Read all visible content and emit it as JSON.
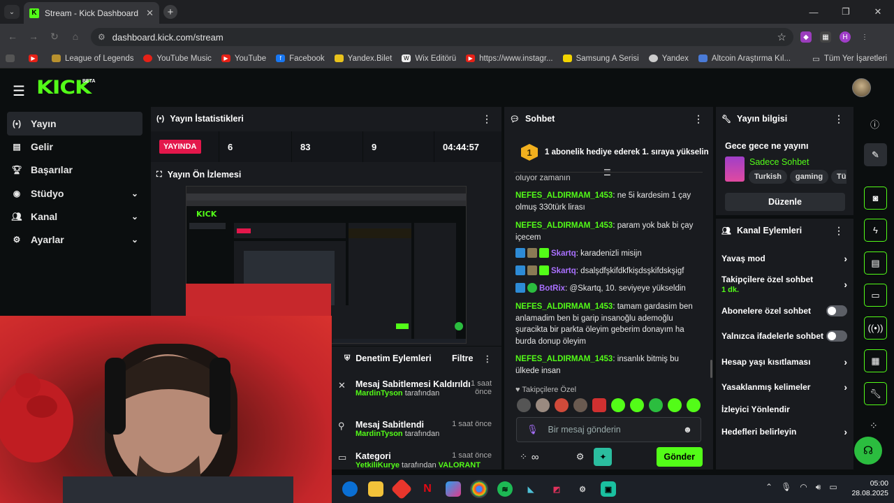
{
  "browser": {
    "tab_title": "Stream - Kick Dashboard",
    "url": "dashboard.kick.com/stream",
    "bookmarks": [
      "League of Legends",
      "YouTube Music",
      "YouTube",
      "Facebook",
      "Yandex.Bilet",
      "Wix Editörü",
      "https://www.instagr...",
      "Samsung A Serisi",
      "Yandex",
      "Altcoin Araştırma Kıl..."
    ],
    "all_bookmarks": "Tüm Yer İşaretleri",
    "ext_profile": "H"
  },
  "header": {
    "logo": "KICK",
    "beta": "BETA"
  },
  "sidebar": {
    "items": [
      {
        "label": "Yayın"
      },
      {
        "label": "Gelir"
      },
      {
        "label": "Başarılar"
      },
      {
        "label": "Stüdyo"
      },
      {
        "label": "Kanal"
      },
      {
        "label": "Ayarlar"
      }
    ]
  },
  "stats": {
    "title": "Yayın İstatistikleri",
    "live_label": "YAYINDA",
    "values": [
      "6",
      "83",
      "9",
      "04:44:57"
    ]
  },
  "preview": {
    "title": "Yayın Ön İzlemesi"
  },
  "moderation": {
    "title": "Denetim Eylemleri",
    "filter": "Filtre",
    "items": [
      {
        "title": "Mesaj Sabitlemesi Kaldırıldı",
        "user": "MardinTyson",
        "by": "tarafından",
        "time": "1 saat önce"
      },
      {
        "title": "Mesaj Sabitlendi",
        "user": "MardinTyson",
        "by": "tarafından",
        "time": "1 saat önce"
      },
      {
        "title": "Kategori",
        "user": "YetkiliKurye",
        "by": "tarafından",
        "extra": "VALORANT",
        "time": "1 saat önce"
      }
    ]
  },
  "chat": {
    "title": "Sohbet",
    "gift_number": "1",
    "gift_text": "1 abonelik hediye ederek 1. sıraya yükselin",
    "partial_top": "oluyor zamanın",
    "messages": [
      {
        "user": "NEFES_ALDIRMAM_1453",
        "text": ": ne 5i kardesim 1 çay olmuş 330türk lirası"
      },
      {
        "user": "NEFES_ALDIRMAM_1453",
        "text": ": param yok bak bi çay içecem"
      },
      {
        "user": "Skartq",
        "text": ": karadenizli misijn"
      },
      {
        "user": "Skartq",
        "text": ": dsalşdfşkifdkfkişdsşkifdskşigf"
      },
      {
        "user": "BotRix",
        "text": ": @Skartq, 10. seviyeye yükseldin"
      },
      {
        "user": "NEFES_ALDIRMAM_1453",
        "text": ": tamam gardasim ben anlamadim ben bi garip insanoğlu ademoğlu şuracikta bir parkta öleyim geberim donayım ha burda donup öleyim"
      },
      {
        "user": "NEFES_ALDIRMAM_1453",
        "text": ": insanlık bitmiş bu ülkede insan"
      }
    ],
    "followers_only": "Takipçilere Özel",
    "input_placeholder": "Bir mesaj gönderin",
    "send": "Gönder"
  },
  "info": {
    "title": "Yayın bilgisi",
    "stream_title": "Gece gece ne yayını",
    "category": "Sadece Sohbet",
    "tags": [
      "Turkish",
      "gaming",
      "Türk"
    ],
    "edit": "Düzenle"
  },
  "channel_actions": {
    "title": "Kanal Eylemleri",
    "items": [
      {
        "label": "Yavaş mod",
        "type": "arrow"
      },
      {
        "label": "Takipçilere özel sohbet",
        "sub": "1 dk.",
        "type": "arrow"
      },
      {
        "label": "Abonelere özel sohbet",
        "type": "toggle"
      },
      {
        "label": "Yalnızca ifadelerle sohbet",
        "type": "toggle"
      },
      {
        "label": "Hesap yaşı kısıtlaması",
        "type": "arrow"
      },
      {
        "label": "Yasaklanmış kelimeler",
        "type": "arrow"
      },
      {
        "label": "İzleyici Yönlendir",
        "type": "none"
      },
      {
        "label": "Hedefleri belirleyin",
        "type": "arrow"
      }
    ]
  },
  "taskbar": {
    "time": "05:00",
    "date": "28.08.2025"
  },
  "colors": {
    "accent": "#53fc18",
    "live": "#e3174b",
    "purple": "#a970ff",
    "panel": "#191b1f"
  }
}
